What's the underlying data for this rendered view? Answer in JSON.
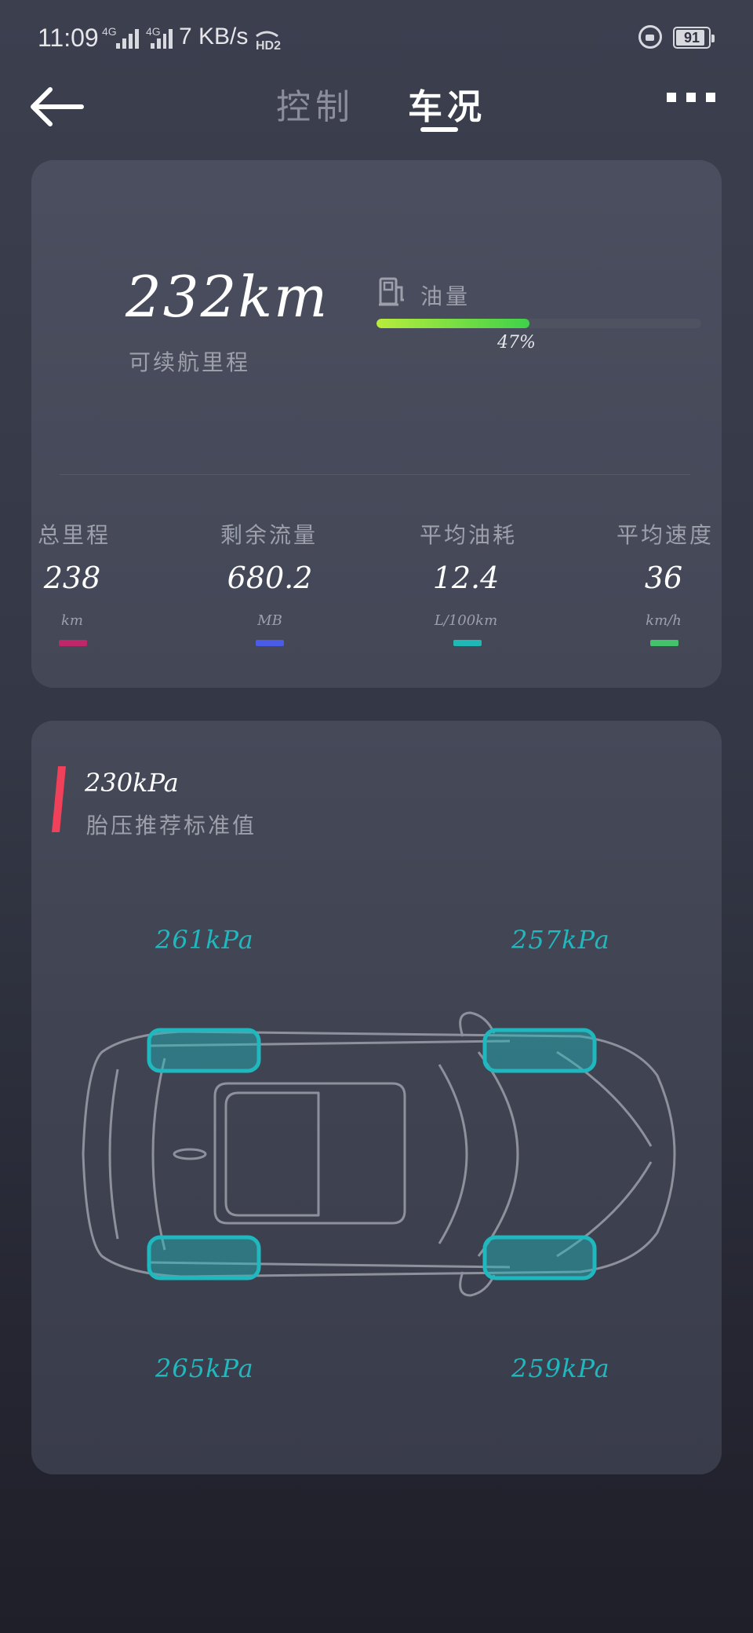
{
  "status_bar": {
    "time": "11:09",
    "network_1": "4G",
    "network_2": "4G",
    "speed": "7 KB/s",
    "hd": "HD2",
    "battery": "91",
    "battery_level": 0.91
  },
  "header": {
    "tabs": [
      {
        "label": "控制",
        "active": false
      },
      {
        "label": "车况",
        "active": true
      }
    ]
  },
  "range": {
    "value": "232km",
    "label": "可续航里程"
  },
  "fuel": {
    "label": "油量",
    "percent_text": "47%",
    "level": 0.47,
    "gradient": [
      "#b8ec3c",
      "#3ed24a"
    ]
  },
  "stats": [
    {
      "label": "总里程",
      "value": "238",
      "unit": "km",
      "color": "#c0266a"
    },
    {
      "label": "剩余流量",
      "value": "680.2",
      "unit": "MB",
      "color": "#4a5be8"
    },
    {
      "label": "平均油耗",
      "value": "12.4",
      "unit": "L/100km",
      "color": "#1fb8b4"
    },
    {
      "label": "平均速度",
      "value": "36",
      "unit": "km/h",
      "color": "#43c46a"
    }
  ],
  "tire_pressure": {
    "recommended_value": "230kPa",
    "recommended_label": "胎压推荐标准值",
    "accent_color": "#f0405a",
    "tire_color": "#1fb8be",
    "tires": {
      "front_left": "261kPa",
      "front_right": "257kPa",
      "rear_left": "265kPa",
      "rear_right": "259kPa"
    }
  }
}
